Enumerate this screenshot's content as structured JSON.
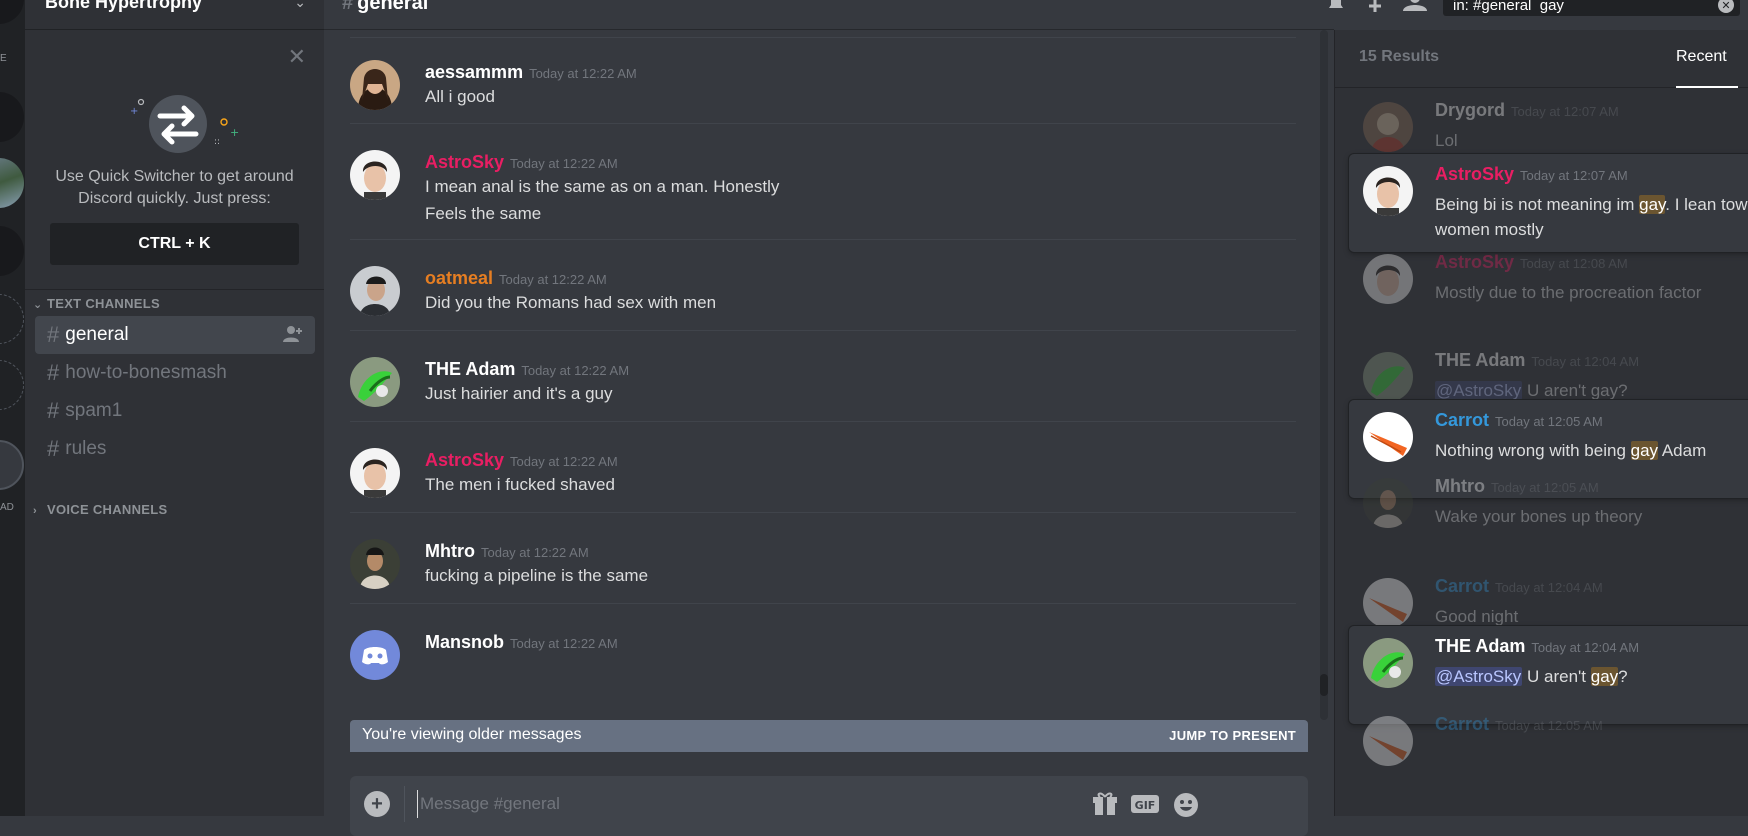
{
  "server": {
    "name": "Bone Hypertrophy",
    "rail_labels": [
      "E",
      "AD"
    ]
  },
  "sidebar": {
    "quick_switcher": {
      "line1": "Use Quick Switcher to get around",
      "line2": "Discord quickly. Just press:",
      "shortcut": "CTRL + K"
    },
    "text_category": "TEXT CHANNELS",
    "voice_category": "VOICE CHANNELS",
    "channels": [
      {
        "name": "general",
        "active": true
      },
      {
        "name": "how-to-bonesmash",
        "active": false
      },
      {
        "name": "spam1",
        "active": false
      },
      {
        "name": "rules",
        "active": false
      }
    ]
  },
  "chat": {
    "channel": "general",
    "messages": [
      {
        "author": "aessammm",
        "color": "#ffffff",
        "time": "Today at 12:22 AM",
        "lines": [
          "All i good"
        ]
      },
      {
        "author": "AstroSky",
        "color": "#e91e63",
        "time": "Today at 12:22 AM",
        "lines": [
          "I mean anal is the same as on a man. Honestly",
          "Feels the same"
        ]
      },
      {
        "author": "oatmeal",
        "color": "#e67e22",
        "time": "Today at 12:22 AM",
        "lines": [
          "Did you the Romans had sex with men"
        ]
      },
      {
        "author": "THE Adam",
        "color": "#ffffff",
        "time": "Today at 12:22 AM",
        "lines": [
          "Just hairier and it's a guy"
        ]
      },
      {
        "author": "AstroSky",
        "color": "#e91e63",
        "time": "Today at 12:22 AM",
        "lines": [
          "The men i fucked shaved"
        ]
      },
      {
        "author": "Mhtro",
        "color": "#ffffff",
        "time": "Today at 12:22 AM",
        "lines": [
          "fucking a pipeline is the same"
        ]
      },
      {
        "author": "Mansnob",
        "color": "#ffffff",
        "time": "Today at 12:22 AM",
        "lines": []
      }
    ],
    "older_notice": "You're viewing older messages",
    "jump_label": "JUMP TO PRESENT",
    "composer_placeholder": "Message #general"
  },
  "search": {
    "query": "in: #general  gay",
    "result_count": "15 Results",
    "sort_tab": "Recent",
    "highlight_color": "#6b5530",
    "results": [
      {
        "author": "Drygord",
        "color": "#ffffff",
        "time": "Today at 12:07 AM",
        "body": "Lol",
        "focus": false
      },
      {
        "author": "AstroSky",
        "color": "#e91e63",
        "time": "Today at 12:07 AM",
        "body_pre": "Being bi is not meaning im ",
        "body_hl": "gay",
        "body_post": ".  I lean towards women mostly",
        "focus": true
      },
      {
        "author": "AstroSky",
        "color": "#e91e63",
        "time": "Today at 12:08 AM",
        "body": "Mostly due to the procreation factor",
        "focus": false
      },
      {
        "author": "THE Adam",
        "color": "#ffffff",
        "time": "Today at 12:04 AM",
        "mention": "@AstroSky",
        "body": " U aren't gay?",
        "focus": false
      },
      {
        "author": "Carrot",
        "color": "#3498db",
        "time": "Today at 12:05 AM",
        "body_pre": "Nothing wrong with being ",
        "body_hl": "gay",
        "body_post": " Adam",
        "focus": true
      },
      {
        "author": "Mhtro",
        "color": "#ffffff",
        "time": "Today at 12:05 AM",
        "body": "Wake your bones up theory",
        "focus": false
      },
      {
        "author": "Carrot",
        "color": "#3498db",
        "time": "Today at 12:04 AM",
        "body": "Good night",
        "focus": false
      },
      {
        "author": "THE Adam",
        "color": "#ffffff",
        "time": "Today at 12:04 AM",
        "mention": "@AstroSky",
        "body_pre": " U aren't ",
        "body_hl": "gay",
        "body_post": "?",
        "focus": true
      },
      {
        "author": "Carrot",
        "color": "#3498db",
        "time": "Today at 12:05 AM",
        "body": "",
        "focus": false
      }
    ]
  }
}
